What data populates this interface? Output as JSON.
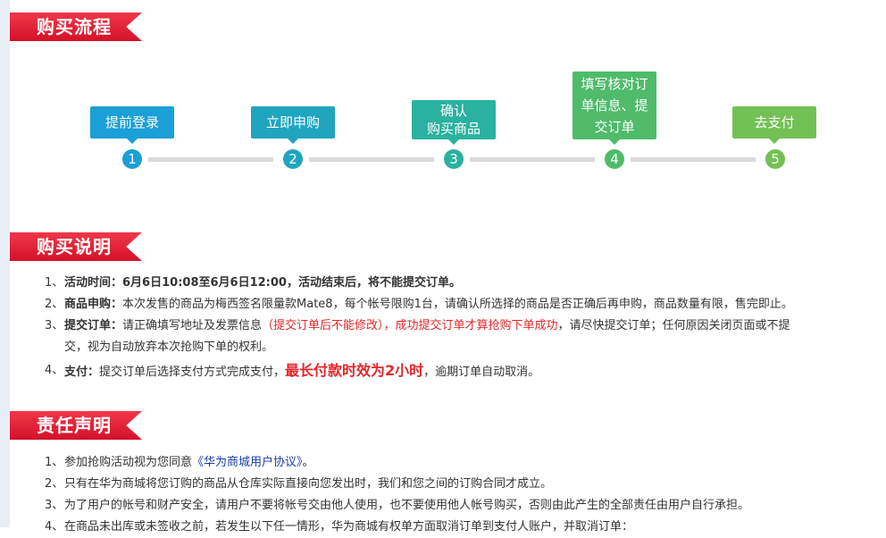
{
  "sections": {
    "flow_title": "购买流程",
    "intro_title": "购买说明",
    "liability_title": "责任声明"
  },
  "steps": [
    {
      "num": "1",
      "label": "提前登录",
      "color": "#1a9fd6"
    },
    {
      "num": "2",
      "label": "立即申购",
      "color": "#20a5bf"
    },
    {
      "num": "3",
      "label_line1": "确认",
      "label_line2": "购买商品",
      "color": "#2ab1a0"
    },
    {
      "num": "4",
      "label_line1": "填写核对订",
      "label_line2": "单信息、提",
      "label_line3": "交订单",
      "color": "#4fbb6b"
    },
    {
      "num": "5",
      "label": "去支付",
      "color": "#72c154"
    }
  ],
  "intro": [
    {
      "num": "1、",
      "head": "活动时间：",
      "text": "6月6日10:08至6月6日12:00，活动结束后，将不能提交订单。"
    },
    {
      "num": "2、",
      "head": "商品申购：",
      "text": "本次发售的商品为梅西签名限量款Mate8，每个帐号限购1台，请确认所选择的商品是否正确后再申购，商品数量有限，售完即止。"
    },
    {
      "num": "3、",
      "head": "提交订单：",
      "text_a": "请正确填写地址及发票信息",
      "text_red": "（提交订单后不能修改），成功提交订单才算抢购下单成功",
      "text_b": "，请尽快提交订单；任何原因关闭页面或不提",
      "text_c": "交，视为自动放弃本次抢购下单的权利。"
    },
    {
      "num": "4、",
      "head": "支付：",
      "text_a": "提交订单后选择支付方式完成支付，",
      "text_big": "最长付款时效为2小时",
      "text_b": "，逾期订单自动取消。"
    }
  ],
  "liability": [
    {
      "num": "1、",
      "text_a": "参加抢购活动视为您同意",
      "link": "《华为商城用户协议》",
      "text_b": "。"
    },
    {
      "num": "2、",
      "text": "只有在华为商城将您订购的商品从仓库实际直接向您发出时，我们和您之间的订购合同才成立。"
    },
    {
      "num": "3、",
      "text": "为了用户的帐号和财产安全，请用户不要将帐号交由他人使用，也不要使用他人帐号购买，否则由此产生的全部责任由用户自行承担。"
    },
    {
      "num": "4、",
      "text": "在商品未出库或未签收之前，若发生以下任一情形，华为商城有权单方面取消订单到支付人账户，并取消订单："
    }
  ]
}
